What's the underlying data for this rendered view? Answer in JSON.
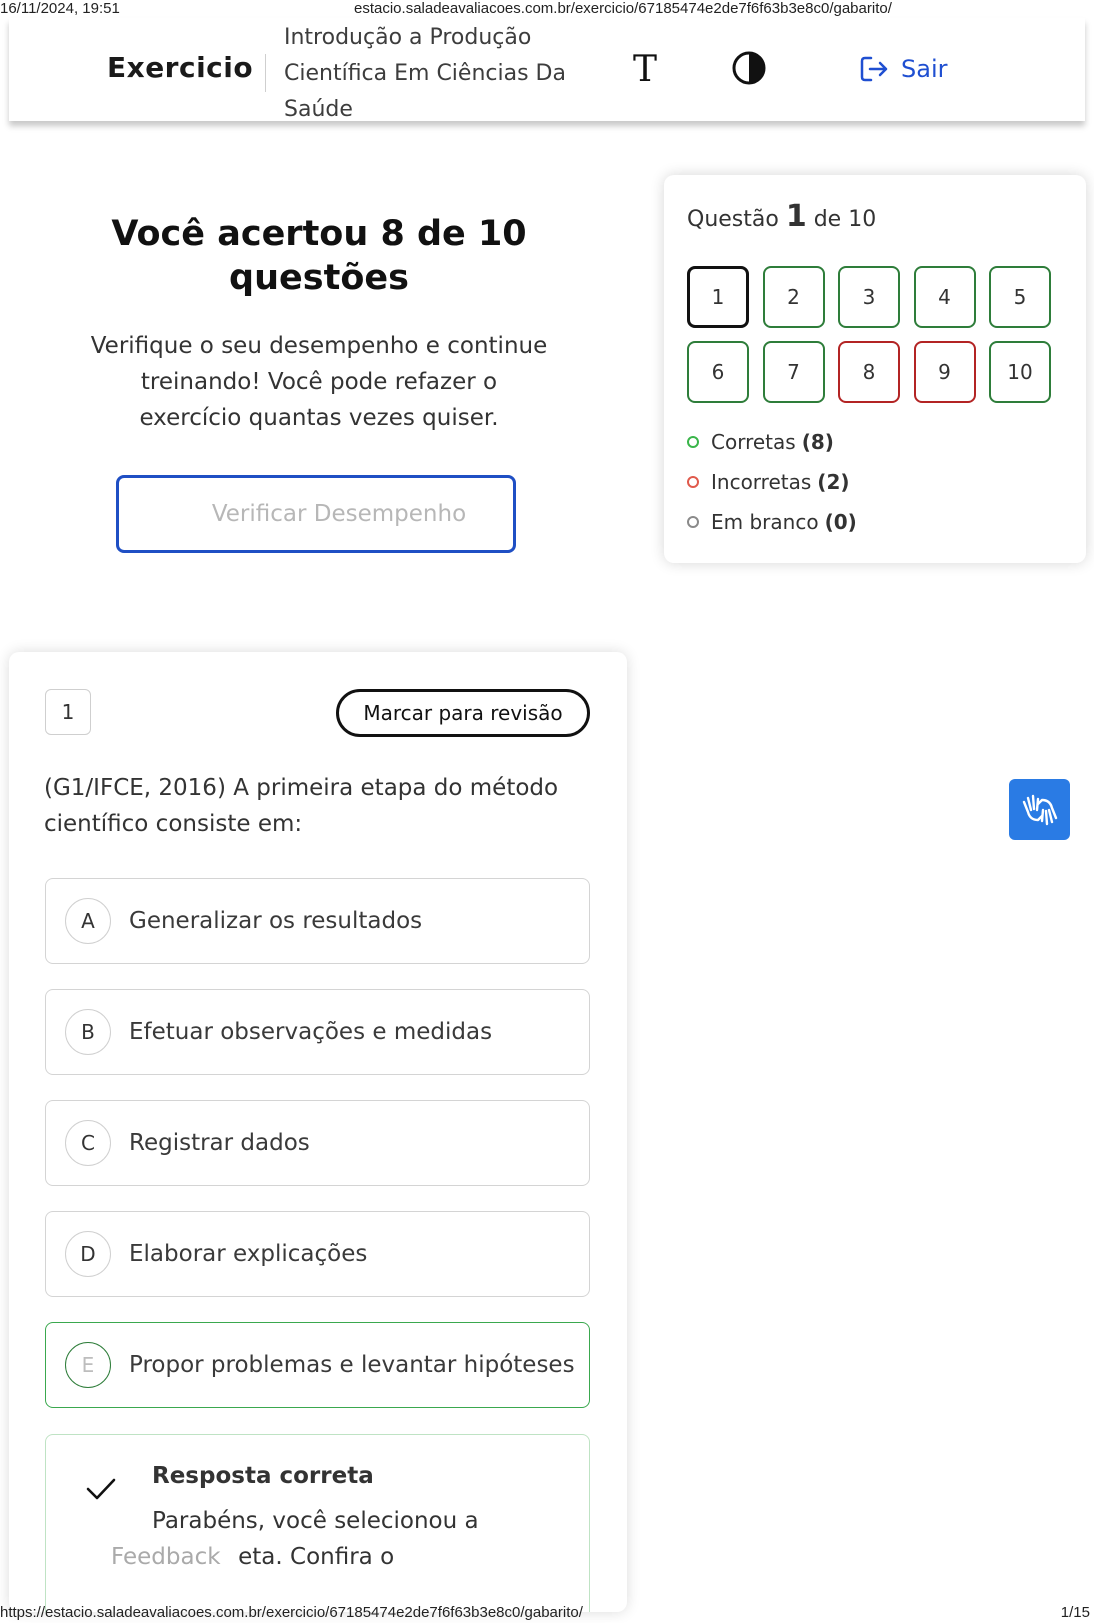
{
  "print_header": {
    "datetime": "16/11/2024, 19:51",
    "url": "estacio.saladeavaliacoes.com.br/exercicio/67185474e2de7f6f63b3e8c0/gabarito/"
  },
  "print_footer": {
    "url": "https://estacio.saladeavaliacoes.com.br/exercicio/67185474e2de7f6f63b3e8c0/gabarito/",
    "page": "1/15"
  },
  "header": {
    "brand": "Exercicio",
    "course_lines": [
      "Introdução a Produção",
      "Científica Em Ciências Da",
      "Saúde"
    ],
    "font_icon_glyph": "T",
    "logout_label": "Sair",
    "accent_color": "#1f4fd1"
  },
  "result": {
    "title": "Você acertou 8 de 10 questões",
    "description": "Verifique o seu desempenho e continue treinando! Você pode refazer o exercício quantas vezes quiser.",
    "button_label": "Verificar Desempenho"
  },
  "navigator": {
    "prefix": "Questão",
    "current": "1",
    "suffix": "de 10",
    "questions": [
      {
        "label": "1",
        "status": "correct",
        "current": true
      },
      {
        "label": "2",
        "status": "correct"
      },
      {
        "label": "3",
        "status": "correct"
      },
      {
        "label": "4",
        "status": "correct"
      },
      {
        "label": "5",
        "status": "correct"
      },
      {
        "label": "6",
        "status": "correct"
      },
      {
        "label": "7",
        "status": "correct"
      },
      {
        "label": "8",
        "status": "wrong"
      },
      {
        "label": "9",
        "status": "wrong"
      },
      {
        "label": "10",
        "status": "correct"
      }
    ],
    "legend": [
      {
        "label": "Corretas",
        "count": "(8)",
        "color": "#3ab54a"
      },
      {
        "label": "Incorretas",
        "count": "(2)",
        "color": "#e05a4c"
      },
      {
        "label": "Em branco",
        "count": "(0)",
        "color": "#8a8a8a"
      }
    ]
  },
  "question": {
    "number": "1",
    "mark_label": "Marcar para revisão",
    "text": "(G1/IFCE, 2016) A primeira etapa do método científico consiste em:",
    "options": [
      {
        "letter": "A",
        "text": "Generalizar os resultados"
      },
      {
        "letter": "B",
        "text": "Efetuar observações e medidas"
      },
      {
        "letter": "C",
        "text": "Registrar dados"
      },
      {
        "letter": "D",
        "text": "Elaborar explicações"
      },
      {
        "letter": "E",
        "text": "Propor problemas e levantar hipóteses",
        "correct": true
      }
    ],
    "feedback": {
      "title": "Resposta correta",
      "text_line1": "Parabéns, você selecionou a",
      "text_line2": "iva correta. Confira o",
      "tab_label": "Feedback"
    }
  },
  "colors": {
    "correct": "#2e7d3a",
    "wrong": "#b32424",
    "primary": "#1f4fc4",
    "libras": "#2a7be4"
  }
}
